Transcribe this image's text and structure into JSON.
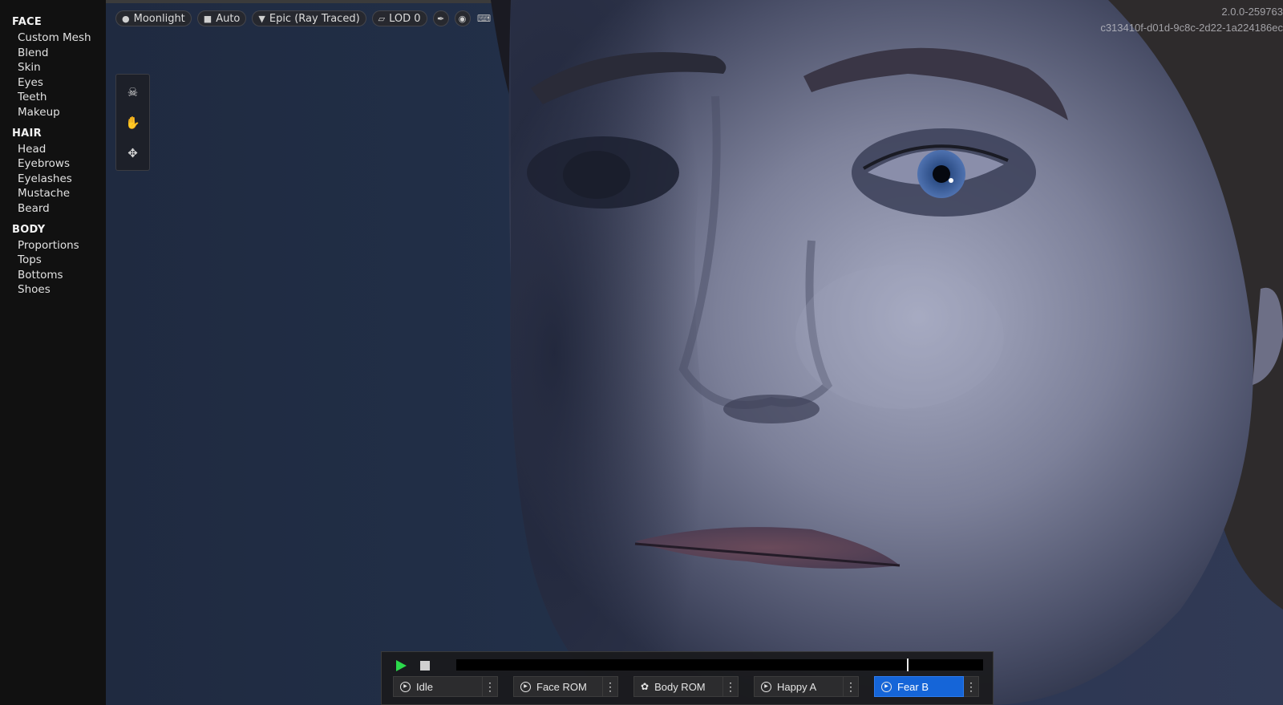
{
  "sidebar": {
    "sections": [
      {
        "title": "FACE",
        "items": [
          "Custom Mesh",
          "Blend",
          "Skin",
          "Eyes",
          "Teeth",
          "Makeup"
        ]
      },
      {
        "title": "HAIR",
        "items": [
          "Head",
          "Eyebrows",
          "Eyelashes",
          "Mustache",
          "Beard"
        ]
      },
      {
        "title": "BODY",
        "items": [
          "Proportions",
          "Tops",
          "Bottoms",
          "Shoes"
        ]
      }
    ]
  },
  "toolbar": {
    "lighting": {
      "label": "Moonlight",
      "icon": "lightbulb-icon"
    },
    "camera": {
      "label": "Auto",
      "icon": "video-camera-icon"
    },
    "quality": {
      "label": "Epic (Ray Traced)",
      "icon": "diamond-icon"
    },
    "lod": {
      "label": "LOD 0",
      "icon": "cube-icon"
    },
    "extra_icons": [
      "brush-icon",
      "head-profile-icon",
      "keyboard-icon"
    ]
  },
  "tool_panel": {
    "icons": [
      "skull-icon",
      "rotate-hand-icon",
      "move-arrows-icon"
    ]
  },
  "version": {
    "line1": "2.0.0-259763",
    "line2": "c313410f-d01d-9c8c-2d22-1a224186ec"
  },
  "animation": {
    "playhead_fraction": 0.855,
    "clips": [
      {
        "label": "Idle",
        "active": false
      },
      {
        "label": "Face ROM",
        "active": false
      },
      {
        "label": "Body ROM",
        "active": false,
        "icon": "running-figure-icon"
      },
      {
        "label": "Happy A",
        "active": false
      },
      {
        "label": "Fear B",
        "active": true
      }
    ],
    "colors": {
      "play": "#2bd94b",
      "active_clip": "#1565d8"
    }
  }
}
